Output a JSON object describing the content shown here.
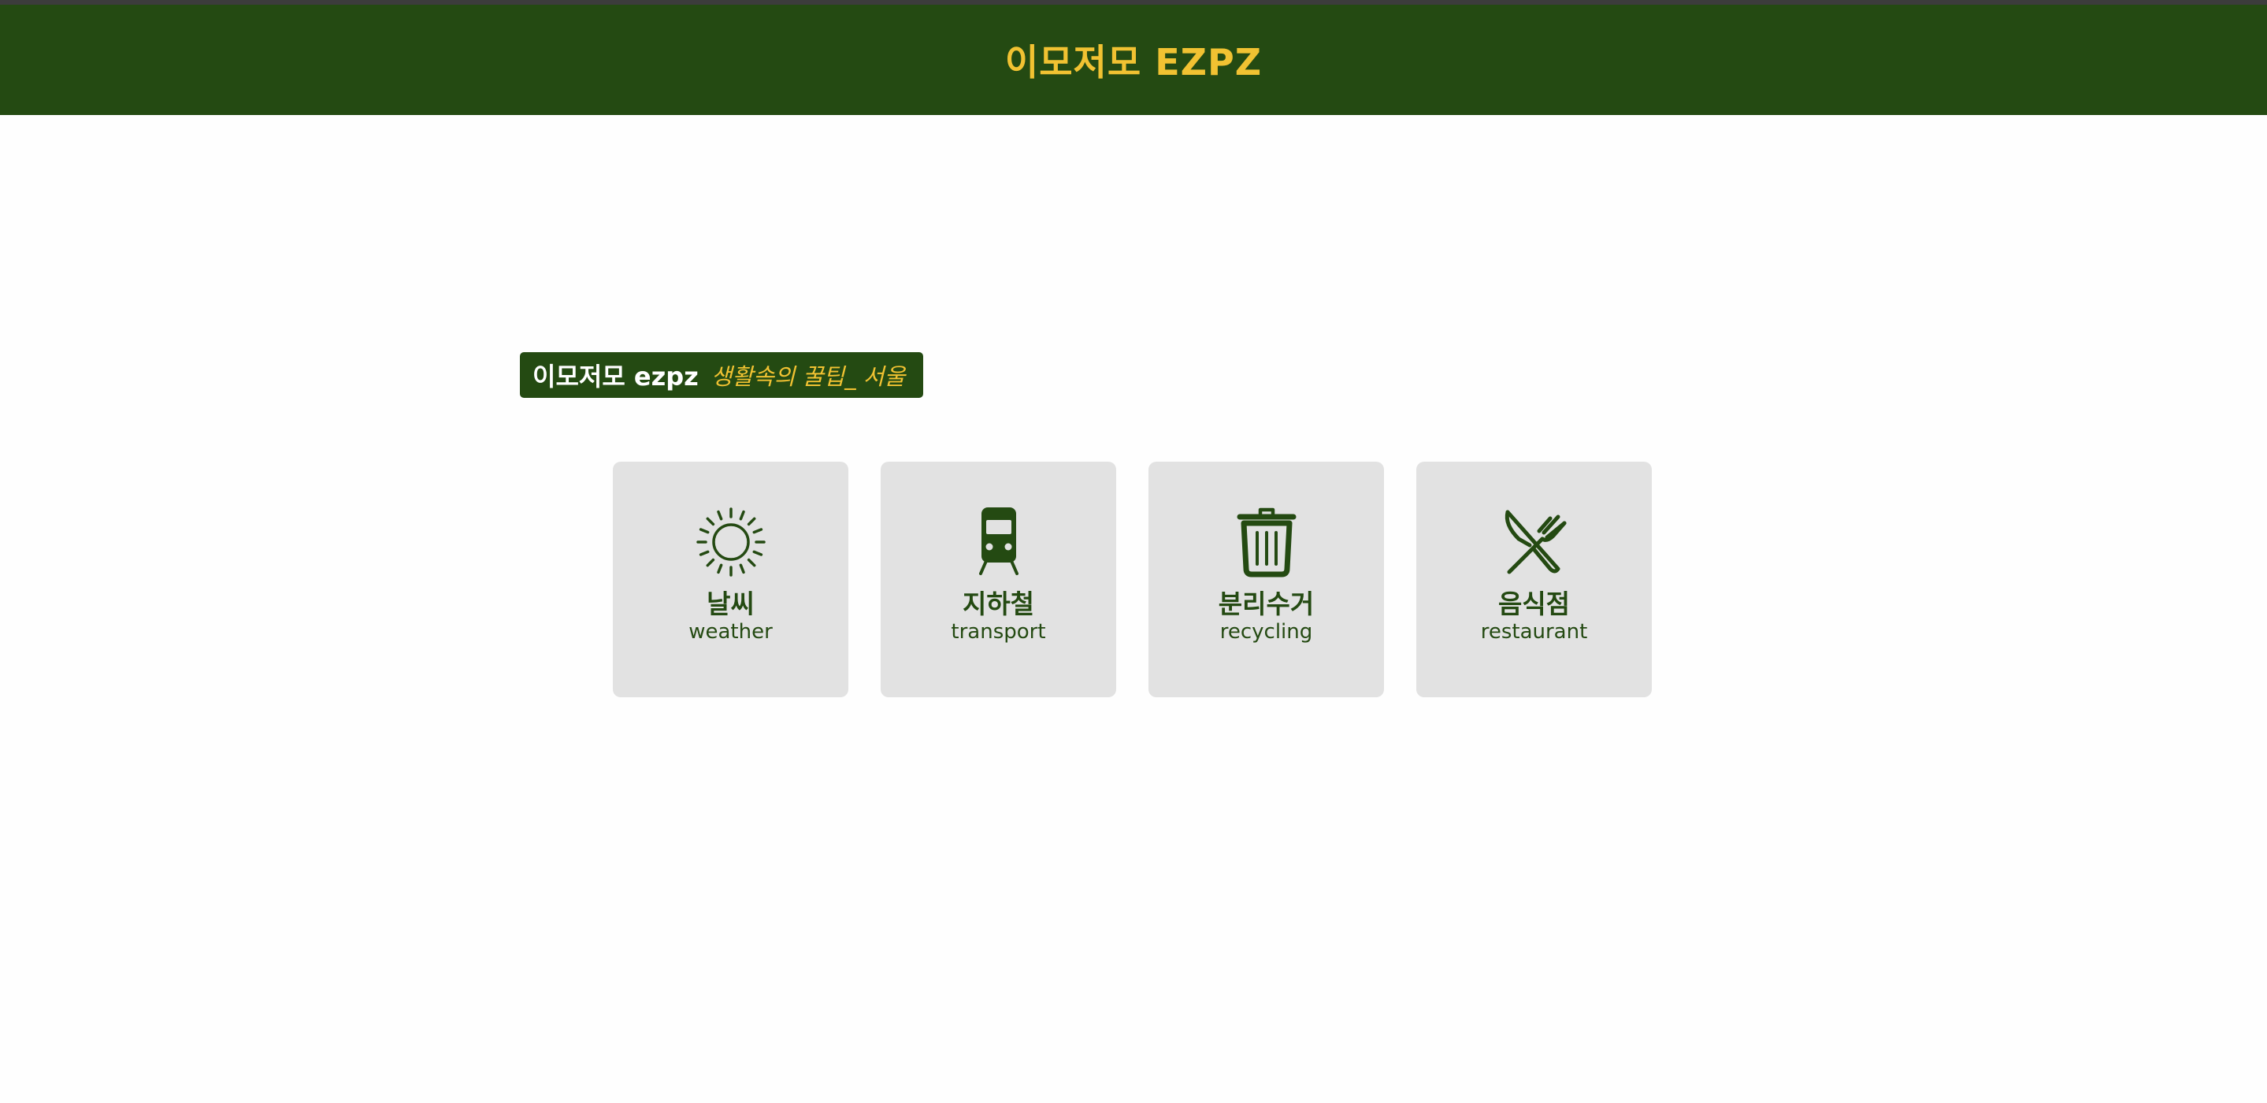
{
  "header": {
    "title": "이모저모 EZPZ"
  },
  "tagline": {
    "brand": "이모저모 ezpz",
    "subtitle": "생활속의 꿀팁_ 서울"
  },
  "cards": [
    {
      "ko": "날씨",
      "en": "weather",
      "icon": "sun-icon"
    },
    {
      "ko": "지하철",
      "en": "transport",
      "icon": "train-icon"
    },
    {
      "ko": "분리수거",
      "en": "recycling",
      "icon": "trash-icon"
    },
    {
      "ko": "음식점",
      "en": "restaurant",
      "icon": "utensils-icon"
    }
  ],
  "colors": {
    "header_bg": "#244a12",
    "accent": "#f1c232",
    "card_bg": "#e2e2e2",
    "icon": "#244a12"
  }
}
